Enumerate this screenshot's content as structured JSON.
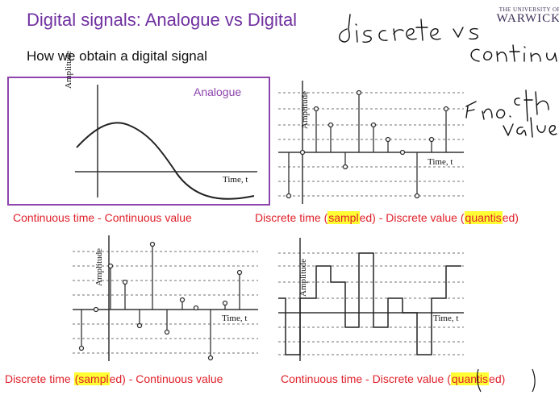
{
  "slide": {
    "title": "Digital signals: Analogue vs Digital",
    "subtitle": "How we obtain a digital signal",
    "logo": {
      "top_line": "THE UNIVERSITY OF",
      "name": "WARWICK"
    }
  },
  "panels": [
    {
      "label": "Analogue",
      "ylabel": "Amplitude",
      "xlabel": "Time, t",
      "caption": "Continuous  time - Continuous value"
    },
    {
      "ylabel": "Amplitude",
      "xlabel": "Time, t",
      "caption_parts": [
        "Discrete time (",
        "sampl",
        "ed) - Discrete value (",
        "quantis",
        "ed)"
      ]
    },
    {
      "ylabel": "Amplitude",
      "xlabel": "Time, t",
      "caption_parts": [
        "Discrete time ",
        "(sampl",
        "ed) - Continuous value"
      ]
    },
    {
      "ylabel": "Amplitude",
      "xlabel": "Time, t",
      "caption_parts": [
        "Continuous  time - Discrete value (",
        "quantis",
        "ed)"
      ]
    }
  ],
  "annotations": [
    "discrete vs continuous",
    "finite no. of values"
  ]
}
